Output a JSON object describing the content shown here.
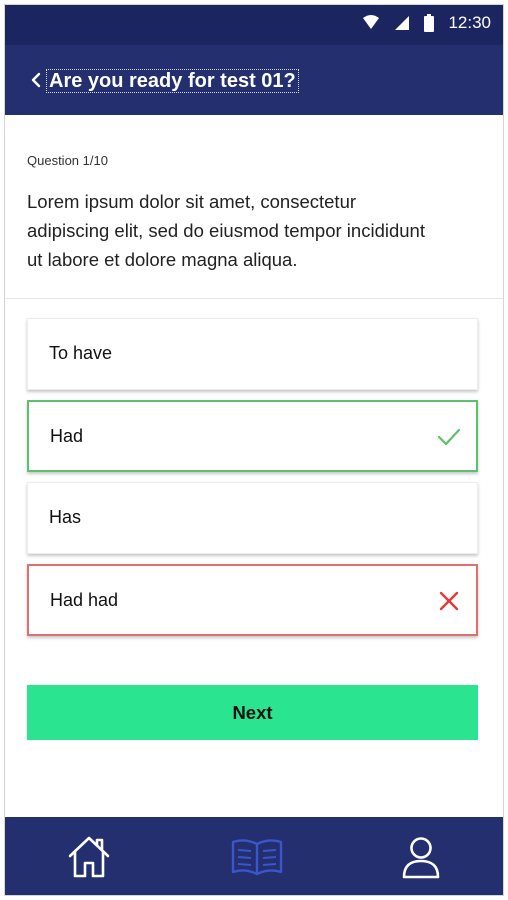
{
  "status_bar": {
    "time": "12:30",
    "icons": [
      "wifi-icon",
      "signal-icon",
      "battery-icon"
    ]
  },
  "header": {
    "title": "Are you ready for test 01?",
    "back_icon": "chevron-left-icon"
  },
  "question": {
    "number_label": "Question 1/10",
    "text": "Lorem ipsum dolor sit amet, consectetur adipiscing elit, sed do eiusmod tempor incididunt ut labore et dolore magna aliqua."
  },
  "options": [
    {
      "label": "To have",
      "state": "default"
    },
    {
      "label": "Had",
      "state": "correct",
      "icon": "check-icon"
    },
    {
      "label": "Has",
      "state": "default"
    },
    {
      "label": "Had had",
      "state": "wrong",
      "icon": "cross-icon"
    }
  ],
  "next_button": {
    "label": "Next"
  },
  "bottom_nav": {
    "items": [
      {
        "icon": "home-icon",
        "active": false
      },
      {
        "icon": "book-icon",
        "active": true
      },
      {
        "icon": "user-icon",
        "active": false
      }
    ]
  },
  "colors": {
    "header": "#232f6e",
    "status_bar": "#1b2560",
    "correct": "#5cc16c",
    "wrong": "#e53935",
    "next_button": "#2ae490",
    "nav_active": "#3a56c8"
  }
}
